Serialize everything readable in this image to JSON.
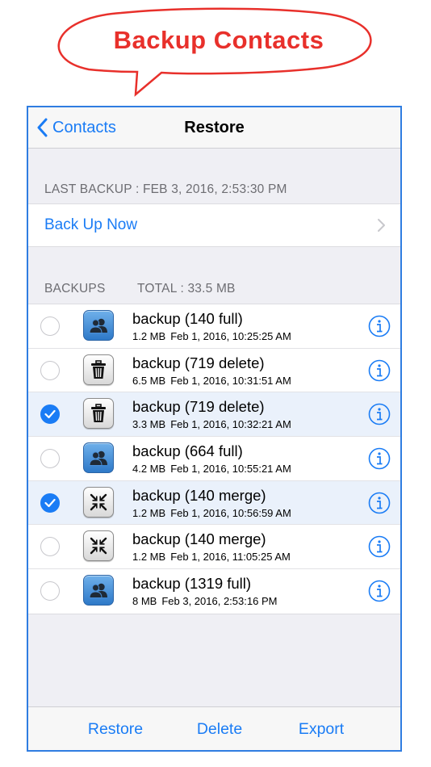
{
  "banner": {
    "title": "Backup Contacts"
  },
  "navbar": {
    "back_label": "Contacts",
    "title": "Restore"
  },
  "last_backup": {
    "header": "LAST BACKUP : FEB 3, 2016, 2:53:30 PM"
  },
  "backup_now": {
    "label": "Back Up Now"
  },
  "backups_section": {
    "header_left": "BACKUPS",
    "header_total": "TOTAL : 33.5 MB"
  },
  "backups": [
    {
      "title": "backup (140 full)",
      "size": "1.2 MB",
      "date": "Feb 1, 2016, 10:25:25 AM",
      "type": "full",
      "selected": false
    },
    {
      "title": "backup (719 delete)",
      "size": "6.5 MB",
      "date": "Feb 1, 2016, 10:31:51 AM",
      "type": "delete",
      "selected": false
    },
    {
      "title": "backup (719 delete)",
      "size": "3.3 MB",
      "date": "Feb 1, 2016, 10:32:21 AM",
      "type": "delete",
      "selected": true
    },
    {
      "title": "backup (664 full)",
      "size": "4.2 MB",
      "date": "Feb 1, 2016, 10:55:21 AM",
      "type": "full",
      "selected": false
    },
    {
      "title": "backup (140 merge)",
      "size": "1.2 MB",
      "date": "Feb 1, 2016, 10:56:59 AM",
      "type": "merge",
      "selected": true
    },
    {
      "title": "backup (140 merge)",
      "size": "1.2 MB",
      "date": "Feb 1, 2016, 11:05:25 AM",
      "type": "merge",
      "selected": false
    },
    {
      "title": "backup (1319 full)",
      "size": "8 MB",
      "date": "Feb 3, 2016, 2:53:16 PM",
      "type": "full",
      "selected": false
    }
  ],
  "toolbar": {
    "restore_label": "Restore",
    "delete_label": "Delete",
    "export_label": "Export"
  },
  "icons": {
    "full": "contacts-group-icon",
    "delete": "trash-icon",
    "merge": "merge-arrows-icon",
    "info": "info-icon",
    "check": "checkmark-icon"
  },
  "colors": {
    "accent": "#1a7cf5",
    "banner_red": "#e8302b",
    "selected_row": "#eaf1fb"
  }
}
